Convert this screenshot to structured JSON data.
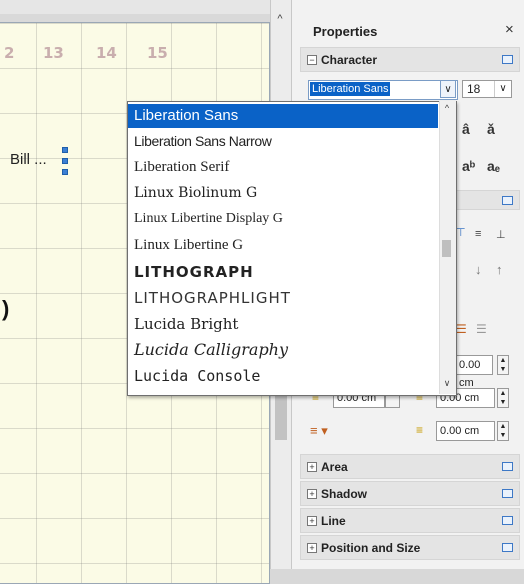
{
  "canvas": {
    "ruler_numbers": [
      "2",
      "13",
      "14",
      "15"
    ],
    "shape_text": "Bill ...",
    "partial_glyph": ")"
  },
  "sidebar": {
    "title": "Properties",
    "close_glyph": "×",
    "character_section": {
      "toggle": "−",
      "label": "Character",
      "font_name": "Liberation Sans",
      "font_size": "18"
    },
    "paragraph_spin_values": [
      "0.00 cm",
      "0.00 cm",
      "0.00 cm",
      "0.00 cm"
    ],
    "sections": [
      {
        "toggle": "+",
        "label": "Area"
      },
      {
        "toggle": "+",
        "label": "Shadow"
      },
      {
        "toggle": "+",
        "label": "Line"
      },
      {
        "toggle": "+",
        "label": "Position and Size"
      }
    ]
  },
  "font_dropdown": {
    "items": [
      "Liberation Sans",
      "Liberation Sans Narrow",
      "Liberation Serif",
      "Linux Biolinum G",
      "Linux Libertine Display G",
      "Linux Libertine G",
      "LITHOGRAPH",
      "LITHOGRAPHLIGHT",
      "Lucida Bright",
      "Lucida Calligraphy",
      "Lucida Console"
    ],
    "selected_index": 0
  },
  "colors": {
    "selection": "#0a62c7",
    "page_background": "#fbfbe6",
    "sidebar_background": "#f2f2f2"
  }
}
